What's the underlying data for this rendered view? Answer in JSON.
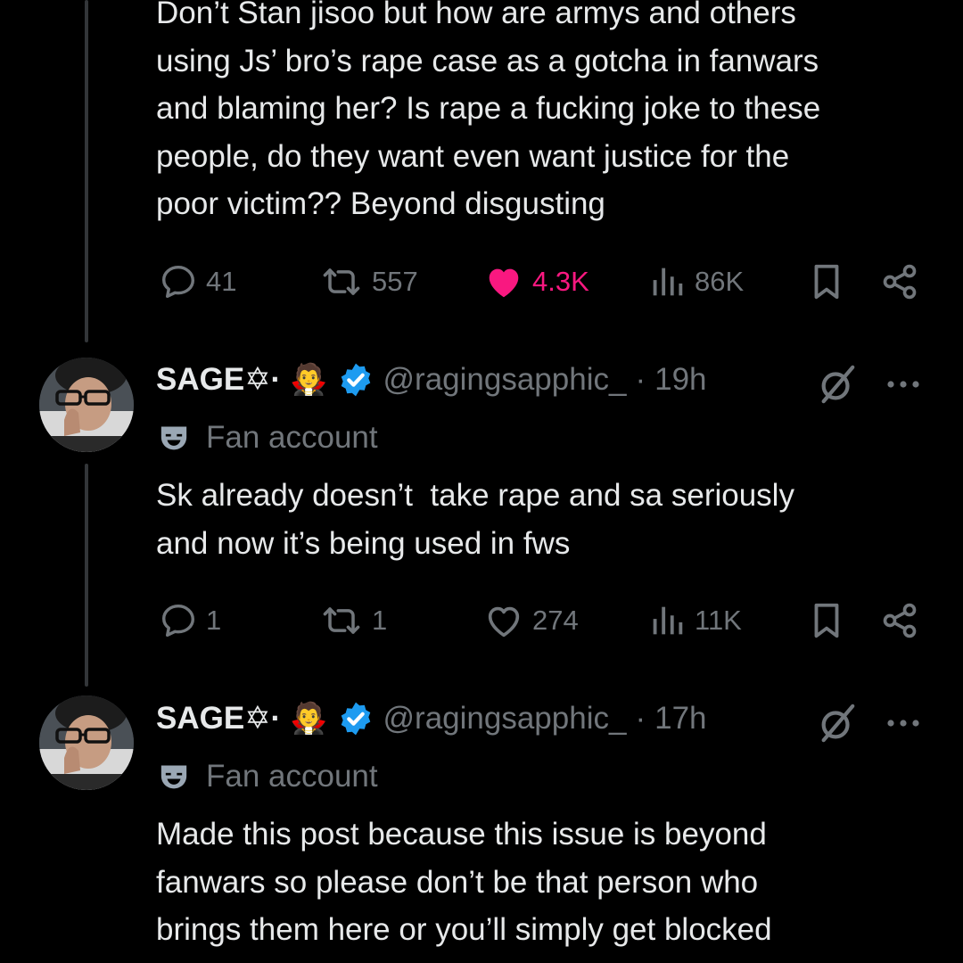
{
  "colors": {
    "background": "#000000",
    "text_primary": "#e7e9ea",
    "text_secondary": "#71767b",
    "like_active": "#f91880",
    "verified": "#1d9bf0"
  },
  "tweets": [
    {
      "text": "Don’t Stan jisoo but how are armys and others\nusing Js’ bro’s rape case as a gotcha in fanwars\nand blaming her? Is rape a fucking joke to these\npeople, do they want even want justice for the\npoor victim?? Beyond disgusting",
      "actions": {
        "replies": "41",
        "reposts": "557",
        "likes": "4.3K",
        "views": "86K",
        "liked": true
      }
    },
    {
      "author": {
        "display_name": "SAGE✡︎·",
        "emoji": "🧛",
        "handle": "@ragingsapphic_",
        "separator": "·",
        "time": "19h",
        "verified": true,
        "label": "Fan account",
        "label_icon": "theater-mask-icon"
      },
      "text": "Sk already doesn’t  take rape and sa seriously\nand now it’s being used in fws",
      "actions": {
        "replies": "1",
        "reposts": "1",
        "likes": "274",
        "views": "11K",
        "liked": false
      }
    },
    {
      "author": {
        "display_name": "SAGE✡︎·",
        "emoji": "🧛",
        "handle": "@ragingsapphic_",
        "separator": "·",
        "time": "17h",
        "verified": true,
        "label": "Fan account",
        "label_icon": "theater-mask-icon"
      },
      "text": "Made this post because this issue is beyond\nfanwars so please don’t be that person who\nbrings them here or you’ll simply get blocked"
    }
  ]
}
